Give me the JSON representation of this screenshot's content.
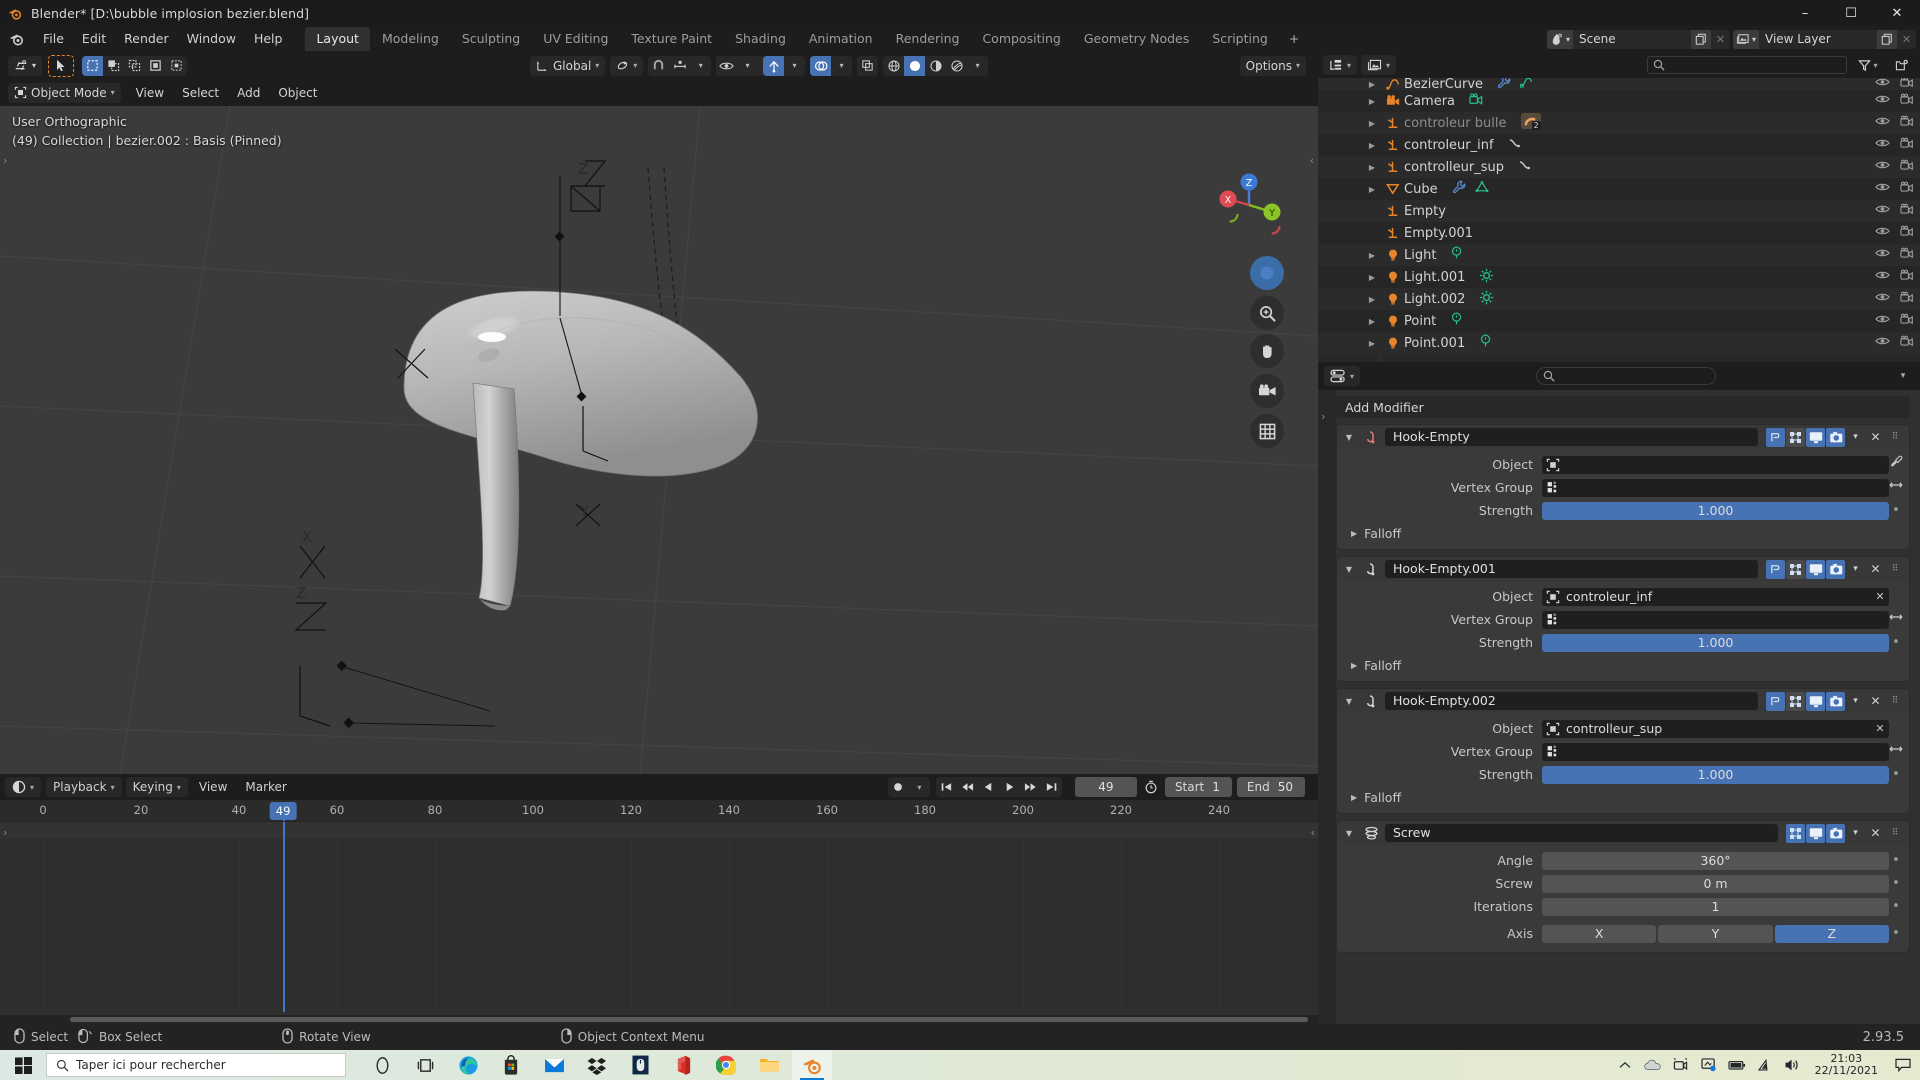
{
  "window": {
    "title": "Blender* [D:\\bubble implosion bezier.blend]",
    "minimize": "–",
    "maximize": "☐",
    "close": "✕"
  },
  "topbar": {
    "menus": [
      "File",
      "Edit",
      "Render",
      "Window",
      "Help"
    ],
    "workspaces": [
      "Layout",
      "Modeling",
      "Sculpting",
      "UV Editing",
      "Texture Paint",
      "Shading",
      "Animation",
      "Rendering",
      "Compositing",
      "Geometry Nodes",
      "Scripting"
    ],
    "active_workspace": "Layout",
    "add_workspace": "+",
    "scene_name": "Scene",
    "view_layer_name": "View Layer"
  },
  "viewport": {
    "mode": "Object Mode",
    "menus": [
      "View",
      "Select",
      "Add",
      "Object"
    ],
    "transform_orientation": "Global",
    "options_label": "Options",
    "overlay_line1": "User Orthographic",
    "overlay_line2": "(49) Collection | bezier.002 : Basis (Pinned)",
    "gizmo_axes": [
      "X",
      "Y",
      "Z"
    ]
  },
  "outliner": {
    "search_placeholder": "",
    "rows": [
      {
        "name": "BezierCurve",
        "icon": "curve-icon",
        "dim": false,
        "expand": true,
        "extras": [
          "modifier-wrench-icon",
          "curve-data-icon"
        ],
        "partial": true
      },
      {
        "name": "Camera",
        "icon": "camera-icon",
        "dim": false,
        "expand": true,
        "extras": [
          "camera-data-icon"
        ]
      },
      {
        "name": "controleur bulle",
        "icon": "empty-axis-icon",
        "dim": true,
        "expand": true,
        "extras": [
          "collection-group-icon-2"
        ]
      },
      {
        "name": "controleur_inf",
        "icon": "empty-axis-icon",
        "dim": false,
        "expand": true,
        "extras": [
          "animation-curve-icon"
        ]
      },
      {
        "name": "controlleur_sup",
        "icon": "empty-axis-icon",
        "dim": false,
        "expand": true,
        "extras": [
          "animation-curve-icon"
        ]
      },
      {
        "name": "Cube",
        "icon": "mesh-cone-icon",
        "dim": false,
        "expand": true,
        "extras": [
          "modifier-wrench-icon",
          "mesh-data-icon"
        ]
      },
      {
        "name": "Empty",
        "icon": "empty-axis-icon",
        "dim": false,
        "expand": false,
        "extras": []
      },
      {
        "name": "Empty.001",
        "icon": "empty-axis-icon",
        "dim": false,
        "expand": false,
        "extras": []
      },
      {
        "name": "Light",
        "icon": "light-icon",
        "dim": false,
        "expand": true,
        "extras": [
          "point-light-data-icon"
        ]
      },
      {
        "name": "Light.001",
        "icon": "light-icon",
        "dim": false,
        "expand": true,
        "extras": [
          "sun-light-data-icon"
        ]
      },
      {
        "name": "Light.002",
        "icon": "light-icon",
        "dim": false,
        "expand": true,
        "extras": [
          "sun-light-data-icon"
        ]
      },
      {
        "name": "Point",
        "icon": "light-icon",
        "dim": false,
        "expand": true,
        "extras": [
          "point-light-data-icon"
        ]
      },
      {
        "name": "Point.001",
        "icon": "light-icon",
        "dim": false,
        "expand": true,
        "extras": [
          "point-light-data-icon"
        ]
      }
    ]
  },
  "properties": {
    "add_modifier_label": "Add Modifier",
    "falloff_label": "Falloff",
    "modifiers": [
      {
        "name": "Hook-Empty",
        "icon": "hook-icon",
        "icon_color": "#e07a7a",
        "fields": [
          {
            "label": "Object",
            "type": "object",
            "value": "",
            "icon": "object-empty-icon",
            "clear": false
          },
          {
            "label": "Vertex Group",
            "type": "vgroup",
            "value": "",
            "icon": "vertex-group-icon"
          },
          {
            "label": "Strength",
            "type": "slider",
            "value": "1.000"
          }
        ],
        "toggles": {
          "edit_mode": true,
          "on_cage": false,
          "realtime": true,
          "render": true
        }
      },
      {
        "name": "Hook-Empty.001",
        "icon": "hook-icon",
        "icon_color": "#d6d6d6",
        "fields": [
          {
            "label": "Object",
            "type": "object",
            "value": "controleur_inf",
            "icon": "object-empty-icon",
            "clear": true
          },
          {
            "label": "Vertex Group",
            "type": "vgroup",
            "value": "",
            "icon": "vertex-group-icon"
          },
          {
            "label": "Strength",
            "type": "slider",
            "value": "1.000"
          }
        ],
        "toggles": {
          "edit_mode": true,
          "on_cage": false,
          "realtime": true,
          "render": true
        }
      },
      {
        "name": "Hook-Empty.002",
        "icon": "hook-icon",
        "icon_color": "#d6d6d6",
        "fields": [
          {
            "label": "Object",
            "type": "object",
            "value": "controlleur_sup",
            "icon": "object-empty-icon",
            "clear": true
          },
          {
            "label": "Vertex Group",
            "type": "vgroup",
            "value": "",
            "icon": "vertex-group-icon"
          },
          {
            "label": "Strength",
            "type": "slider",
            "value": "1.000"
          }
        ],
        "toggles": {
          "edit_mode": true,
          "on_cage": false,
          "realtime": true,
          "render": true
        }
      },
      {
        "name": "Screw",
        "icon": "screw-icon",
        "icon_color": "#d6d6d6",
        "fields": [
          {
            "label": "Angle",
            "type": "num",
            "value": "360°"
          },
          {
            "label": "Screw",
            "type": "num",
            "value": "0 m"
          },
          {
            "label": "Iterations",
            "type": "num",
            "value": "1"
          },
          {
            "label": "Axis",
            "type": "axis",
            "options": [
              "X",
              "Y",
              "Z"
            ],
            "selected": "Z"
          }
        ],
        "toggles": {
          "edit_mode": false,
          "on_cage": true,
          "realtime": true,
          "render": true
        },
        "no_falloff": true
      }
    ]
  },
  "timeline": {
    "menus": [
      "Playback",
      "Keying",
      "View",
      "Marker"
    ],
    "current_frame": "49",
    "start_label": "Start",
    "start_value": "1",
    "end_label": "End",
    "end_value": "50",
    "ticks": [
      "0",
      "20",
      "40",
      "60",
      "80",
      "100",
      "120",
      "140",
      "160",
      "180",
      "200",
      "220",
      "240"
    ],
    "playhead_label": "49"
  },
  "status": {
    "items": [
      {
        "label": "Select",
        "icon": "mouse-left-icon"
      },
      {
        "label": "Box Select",
        "icon": "mouse-left-drag-icon"
      },
      {
        "label": "Rotate View",
        "icon": "mouse-middle-icon"
      },
      {
        "label": "Object Context Menu",
        "icon": "mouse-right-icon"
      }
    ],
    "version": "2.93.5"
  },
  "taskbar": {
    "search_placeholder": "Taper ici pour rechercher",
    "apps": [
      "cortana-icon",
      "task-view-icon",
      "edge-icon",
      "store-icon",
      "mail-icon",
      "dropbox-icon",
      "mouse-app-icon",
      "office-icon",
      "chrome-icon",
      "explorer-icon",
      "blender-icon"
    ],
    "active_app": "blender-icon",
    "time": "21:03",
    "date": "22/11/2021"
  },
  "colors": {
    "accent_blue": "#4772b3",
    "orange": "#e8842a",
    "bg_dark": "#1d1d1d",
    "panel": "#3a3a3a"
  }
}
